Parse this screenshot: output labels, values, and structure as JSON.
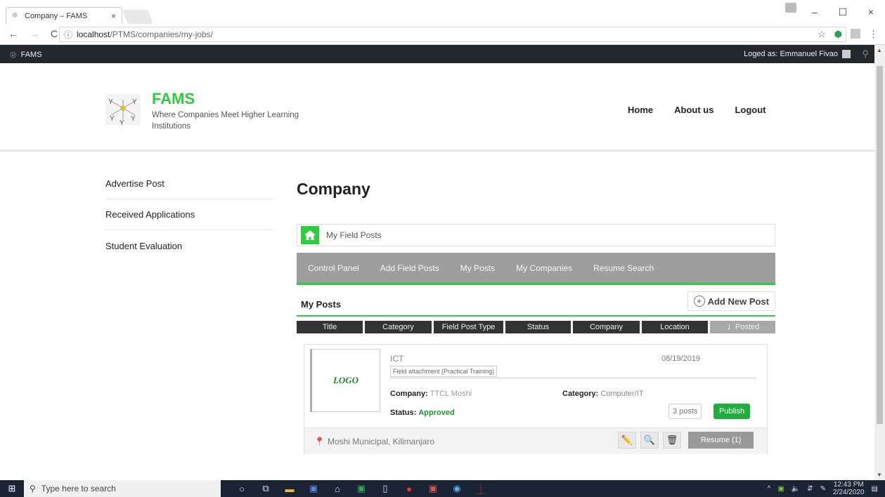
{
  "browser": {
    "tab_title": "Company – FAMS",
    "tab_close": "×",
    "url_host": "localhost",
    "url_path": "/PTMS/companies/my-jobs/",
    "win_min": "–",
    "win_max": "☐",
    "win_close": "×"
  },
  "topbar": {
    "brand": "FAMS",
    "user_label": "Loged as: Emmanuel Fivao"
  },
  "header": {
    "title": "FAMS",
    "tagline": "Where Companies Meet Higher Learning Institutions",
    "nav": [
      "Home",
      "About us",
      "Logout"
    ]
  },
  "sidebar": {
    "items": [
      "Advertise Post",
      "Received Applications",
      "Student Evaluation"
    ]
  },
  "main": {
    "page_title": "Company",
    "breadcrumb": "My Field Posts",
    "subnav": [
      "Control Panel",
      "Add Field Posts",
      "My Posts",
      "My Companies",
      "Resume Search"
    ],
    "section_title": "My Posts",
    "add_new_label": "Add New Post",
    "columns": [
      "Title",
      "Category",
      "Field Post Type",
      "Status",
      "Company",
      "Location",
      "Posted"
    ],
    "post": {
      "logo_text": "LOGO",
      "title": "ICT",
      "type": "Field attachment (Practical Training)",
      "date": "08/19/2019",
      "company_label": "Company:",
      "company": "TTCL Moshi",
      "category_label": "Category:",
      "category": "Computer/IT",
      "status_label": "Status:",
      "status": "Approved",
      "posts_count": "3 posts",
      "publish_label": "Publish",
      "location": "Moshi Municipal, Kilimanjaro",
      "resume_label": "Resume (1)"
    }
  },
  "taskbar": {
    "search_placeholder": "Type here to search",
    "time": "12:43 PM",
    "date": "2/24/2020"
  },
  "colors": {
    "accent": "#2ecc40",
    "topbar": "#23282d",
    "subnav": "#9e9e9e",
    "publish": "#1fae3e"
  }
}
